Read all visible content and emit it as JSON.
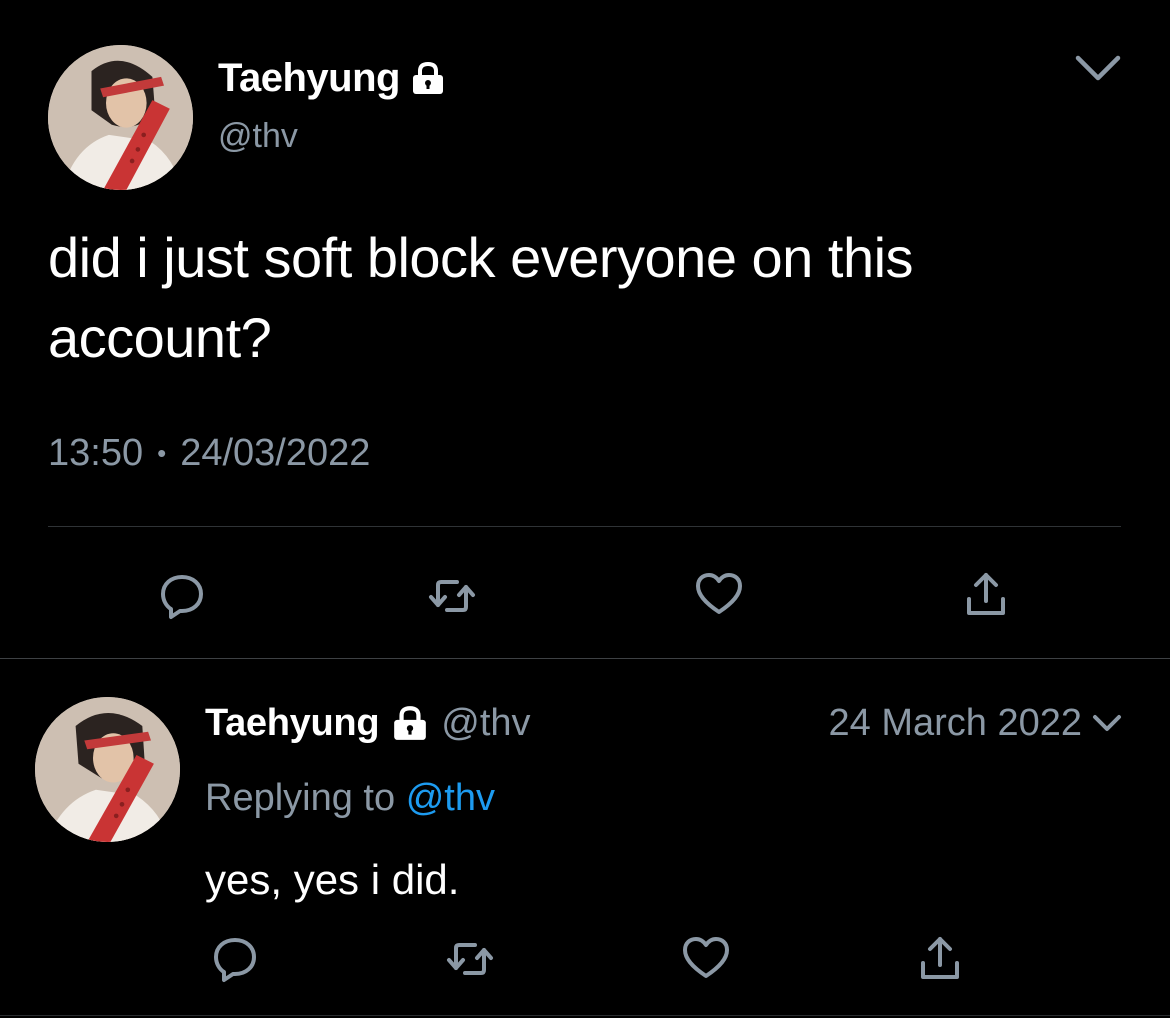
{
  "main_tweet": {
    "display_name": "Taehyung",
    "handle": "@thv",
    "text": "did i just soft block everyone on this account?",
    "time": "13:50",
    "separator": "•",
    "date": "24/03/2022",
    "actions": [
      "reply-icon",
      "retweet-icon",
      "like-icon",
      "share-icon"
    ]
  },
  "reply_tweet": {
    "display_name": "Taehyung",
    "handle": "@thv",
    "date": "24 March 2022",
    "replying_prefix": "Replying to",
    "replying_handle": "@thv",
    "text": "yes, yes i did.",
    "actions": [
      "reply-icon",
      "retweet-icon",
      "like-icon",
      "share-icon"
    ]
  },
  "colors": {
    "background": "#000000",
    "text": "#ffffff",
    "secondary_text": "#8b98a5",
    "link": "#1d9bf0",
    "divider": "#2f3336"
  }
}
